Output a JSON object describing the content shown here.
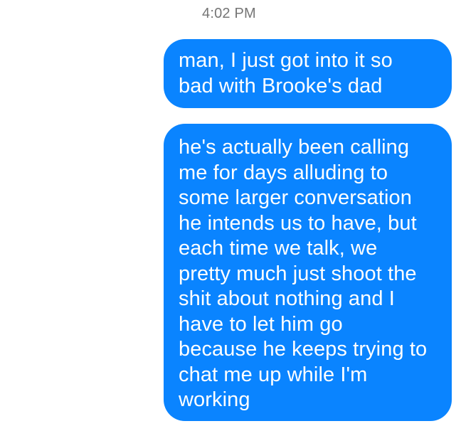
{
  "conversation": {
    "timestamp": "4:02 PM",
    "messages": [
      {
        "lines": [
          "man, I just got into it so",
          "bad with Brooke's dad"
        ]
      },
      {
        "lines": [
          "he's actually been calling",
          "me for days alluding to",
          "some larger conversation",
          "he intends us to have, but",
          "each time we talk, we",
          "pretty much just shoot the",
          "shit about nothing and I",
          "have to let him go",
          "because he keeps trying to",
          "chat me up while I'm",
          "working"
        ]
      }
    ]
  },
  "colors": {
    "sent_bubble": "#0a84ff",
    "bubble_text": "#ffffff",
    "timestamp_text": "#757575",
    "background": "#ffffff"
  }
}
